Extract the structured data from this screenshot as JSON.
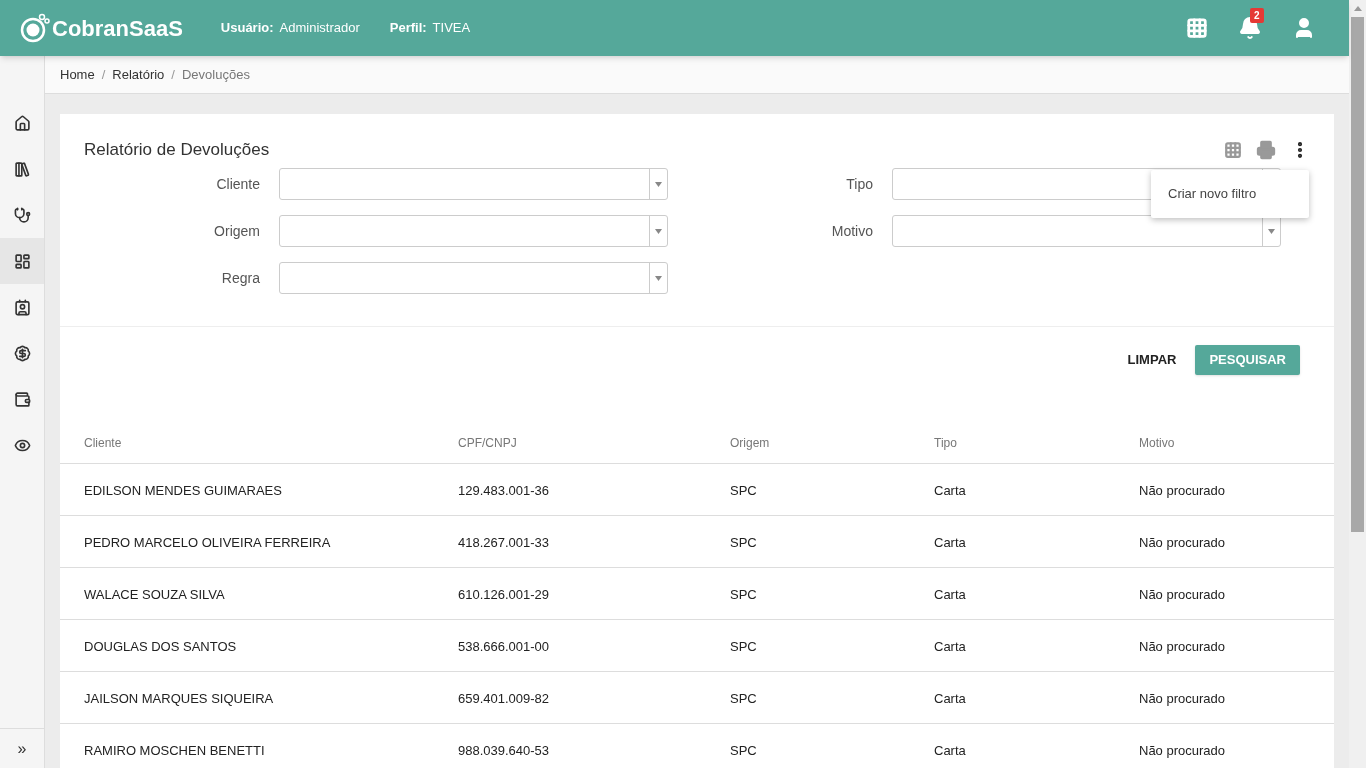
{
  "header": {
    "logo": "CobranSaaS",
    "user_label": "Usuário:",
    "user_value": "Administrador",
    "profile_label": "Perfil:",
    "profile_value": "TIVEA",
    "notification_count": "2"
  },
  "sidebar": {
    "items": [
      {
        "kind": "home",
        "selected": false
      },
      {
        "kind": "library",
        "selected": false
      },
      {
        "kind": "stethoscope",
        "selected": false
      },
      {
        "kind": "widgets",
        "selected": true
      },
      {
        "kind": "contact",
        "selected": false
      },
      {
        "kind": "money",
        "selected": false
      },
      {
        "kind": "wallet",
        "selected": false
      },
      {
        "kind": "eye",
        "selected": false
      }
    ],
    "expand": "»"
  },
  "breadcrumb": [
    {
      "label": "Home",
      "current": false
    },
    {
      "label": "Relatório",
      "current": false
    },
    {
      "label": "Devoluções",
      "current": true
    }
  ],
  "breadcrumb_separator": "/",
  "card": {
    "title": "Relatório de Devoluções",
    "menu": {
      "open": true,
      "items": [
        "Criar novo filtro"
      ]
    }
  },
  "filters": {
    "left": [
      {
        "label": "Cliente"
      },
      {
        "label": "Origem"
      },
      {
        "label": "Regra"
      }
    ],
    "right": [
      {
        "label": "Tipo"
      },
      {
        "label": "Motivo"
      }
    ]
  },
  "buttons": {
    "clear": "LIMPAR",
    "search": "PESQUISAR"
  },
  "table": {
    "columns": [
      "Cliente",
      "CPF/CNPJ",
      "Origem",
      "Tipo",
      "Motivo"
    ],
    "rows": [
      [
        "EDILSON MENDES GUIMARAES",
        "129.483.001-36",
        "SPC",
        "Carta",
        "Não procurado"
      ],
      [
        "PEDRO MARCELO OLIVEIRA FERREIRA",
        "418.267.001-33",
        "SPC",
        "Carta",
        "Não procurado"
      ],
      [
        "WALACE SOUZA SILVA",
        "610.126.001-29",
        "SPC",
        "Carta",
        "Não procurado"
      ],
      [
        "DOUGLAS DOS SANTOS",
        "538.666.001-00",
        "SPC",
        "Carta",
        "Não procurado"
      ],
      [
        "JAILSON MARQUES SIQUEIRA",
        "659.401.009-82",
        "SPC",
        "Carta",
        "Não procurado"
      ],
      [
        "RAMIRO MOSCHEN BENETTI",
        "988.039.640-53",
        "SPC",
        "Carta",
        "Não procurado"
      ]
    ]
  }
}
